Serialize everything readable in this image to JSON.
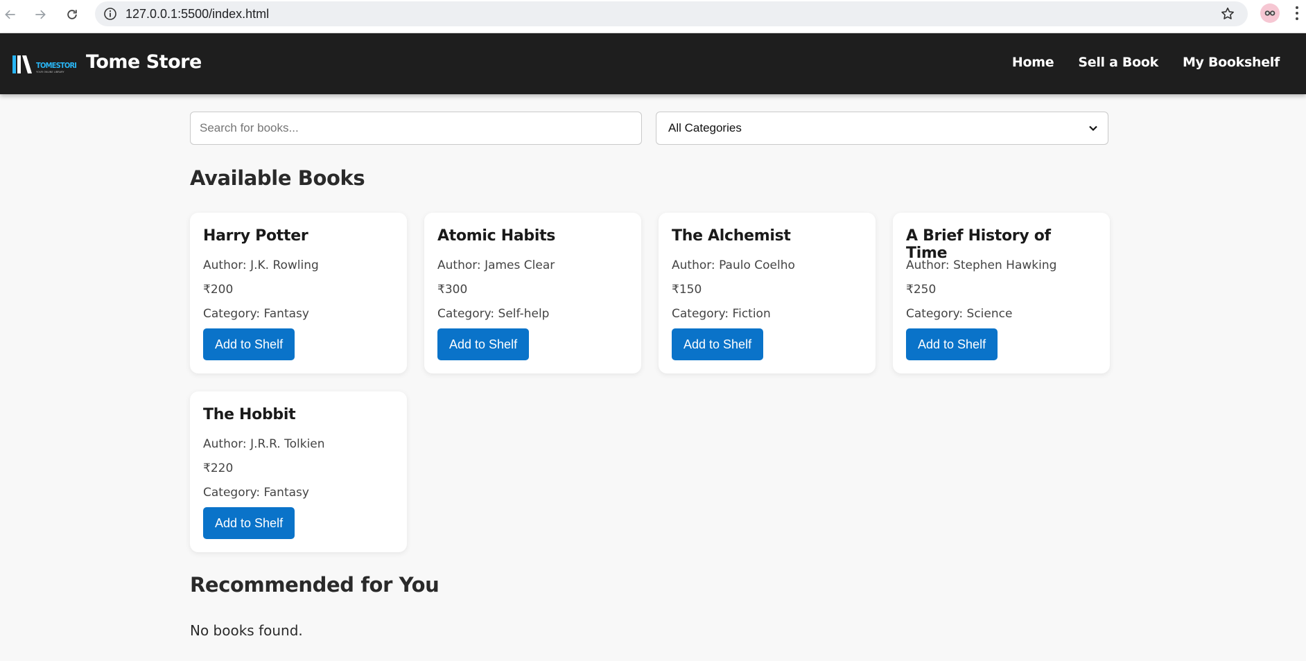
{
  "browser": {
    "url": "127.0.0.1:5500/index.html"
  },
  "header": {
    "logo_text": "TOMESTORE",
    "logo_tagline": "YOUR ONLINE LIBRARY",
    "brand": "Tome Store",
    "nav": [
      "Home",
      "Sell a Book",
      "My Bookshelf"
    ]
  },
  "controls": {
    "search_placeholder": "Search for books...",
    "category_selected": "All Categories"
  },
  "available": {
    "title": "Available Books",
    "books": [
      {
        "title": "Harry Potter",
        "author": "Author: J.K. Rowling",
        "price": "₹200",
        "category": "Category: Fantasy",
        "button": "Add to Shelf"
      },
      {
        "title": "Atomic Habits",
        "author": "Author: James Clear",
        "price": "₹300",
        "category": "Category: Self-help",
        "button": "Add to Shelf"
      },
      {
        "title": "The Alchemist",
        "author": "Author: Paulo Coelho",
        "price": "₹150",
        "category": "Category: Fiction",
        "button": "Add to Shelf"
      },
      {
        "title": "A Brief History of Time",
        "author": "Author: Stephen Hawking",
        "price": "₹250",
        "category": "Category: Science",
        "button": "Add to Shelf"
      },
      {
        "title": "The Hobbit",
        "author": "Author: J.R.R. Tolkien",
        "price": "₹220",
        "category": "Category: Fantasy",
        "button": "Add to Shelf"
      }
    ]
  },
  "recommended": {
    "title": "Recommended for You",
    "empty_text": "No books found."
  },
  "colors": {
    "header_bg": "#1e1e1e",
    "accent_button": "#0a73c9",
    "page_bg": "#f8f8f8"
  }
}
